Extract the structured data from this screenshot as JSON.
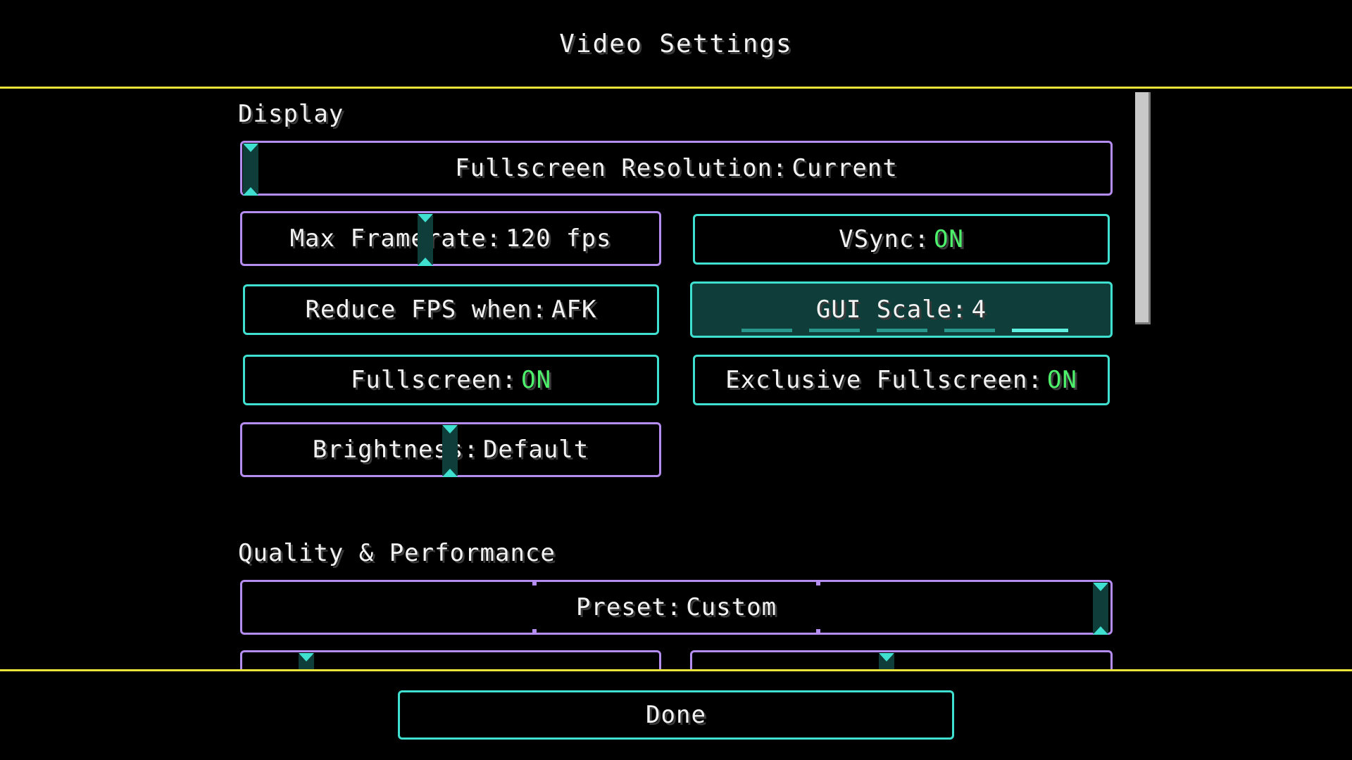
{
  "screen": {
    "title": "Video Settings"
  },
  "sections": {
    "display": "Display",
    "quality": "Quality & Performance"
  },
  "options": {
    "fullscreen_resolution": {
      "label": "Fullscreen Resolution:",
      "value": "Current"
    },
    "max_framerate": {
      "label": "Max Framerate:",
      "value": "120 fps"
    },
    "vsync": {
      "label": "VSync:",
      "value": "ON"
    },
    "reduce_fps": {
      "label": "Reduce FPS when:",
      "value": "AFK"
    },
    "gui_scale": {
      "label": "GUI Scale:",
      "value": "4"
    },
    "fullscreen": {
      "label": "Fullscreen:",
      "value": "ON"
    },
    "exclusive_fullscreen": {
      "label": "Exclusive Fullscreen:",
      "value": "ON"
    },
    "brightness": {
      "label": "Brightness:",
      "value": "Default"
    },
    "preset": {
      "label": "Preset:",
      "value": "Custom"
    }
  },
  "footer": {
    "done_label": "Done"
  },
  "colors": {
    "accent_cyan": "#3fe0d0",
    "slider_purple": "#b58cf0",
    "on_green": "#4df06a",
    "divider_yellow": "#e9e33a",
    "active_fill": "#0f3e3a"
  }
}
